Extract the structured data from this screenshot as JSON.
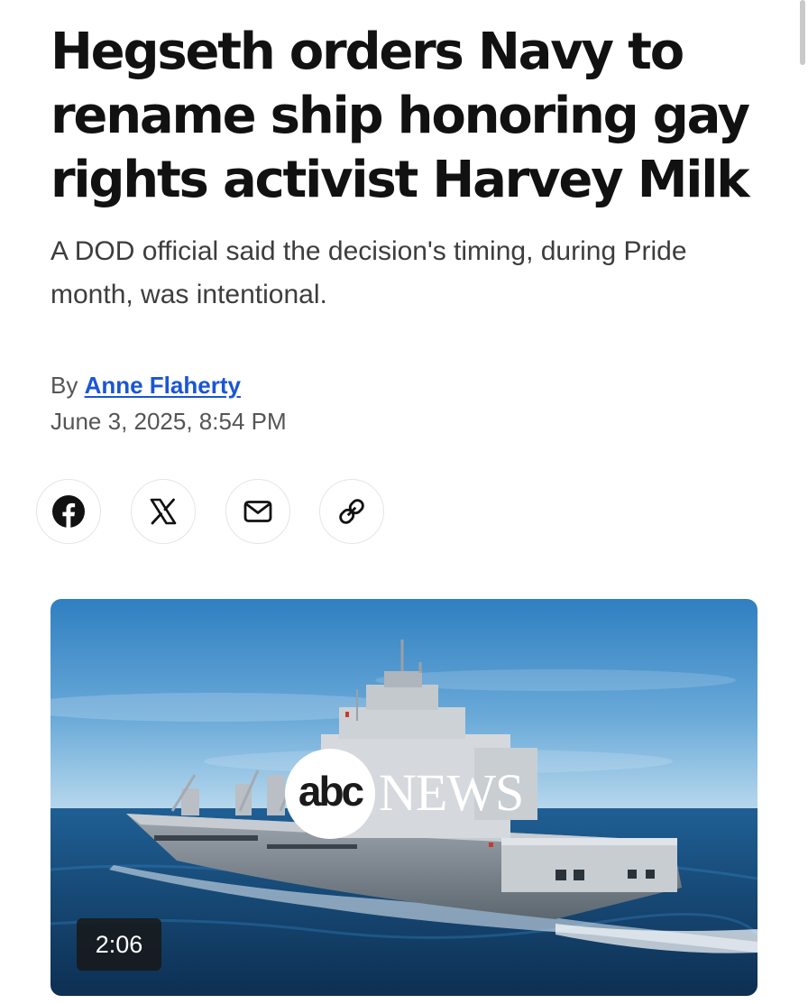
{
  "article": {
    "headline": "Hegseth orders Navy to rename ship honoring gay rights activist Harvey Milk",
    "subheadline": "A DOD official said the decision's timing, during Pride month, was intentional.",
    "byline_prefix": "By",
    "author": "Anne Flaherty",
    "timestamp": "June 3, 2025, 8:54 PM"
  },
  "share": {
    "buttons": [
      {
        "name": "facebook",
        "icon": "facebook-icon"
      },
      {
        "name": "x",
        "icon": "x-icon"
      },
      {
        "name": "email",
        "icon": "mail-icon"
      },
      {
        "name": "copy-link",
        "icon": "link-icon"
      }
    ]
  },
  "video": {
    "duration": "2:06",
    "logo_text": "abc",
    "logo_word": "NEWS"
  },
  "colors": {
    "link": "#1a55d6",
    "headline": "#111111",
    "subtext": "#3d3d3d",
    "meta": "#555555"
  }
}
